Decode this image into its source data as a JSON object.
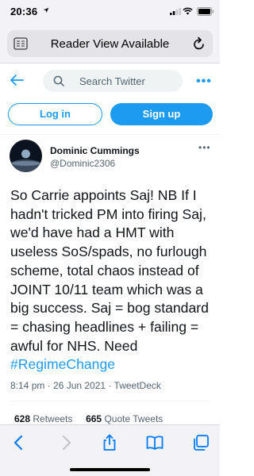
{
  "status_bar": {
    "time": "20:36"
  },
  "browser": {
    "address_text": "Reader View Available"
  },
  "twitter_nav": {
    "search_placeholder": "Search Twitter",
    "more": "•••"
  },
  "auth": {
    "login_label": "Log in",
    "signup_label": "Sign up"
  },
  "tweet": {
    "author_name": "Dominic Cummings",
    "author_handle": "@Dominic2306",
    "more": "•••",
    "text": "So Carrie appoints Saj! NB If I hadn't tricked PM into firing Saj, we'd have had a HMT with useless SoS/spads, no furlough scheme, total chaos instead of JOINT 10/11 team which was a big success. Saj = bog standard = chasing headlines + failing = awful for NHS. Need ",
    "hashtag": "#RegimeChange",
    "meta": "8:14 pm · 26 Jun 2021 · TweetDeck",
    "retweets_count": "628",
    "retweets_label": "Retweets",
    "quotes_count": "665",
    "quotes_label": "Quote Tweets"
  },
  "colors": {
    "accent": "#1d9bf0",
    "safari_blue": "#007aff",
    "text": "#0f1419",
    "muted": "#536471"
  },
  "icons": [
    "location-arrow-icon",
    "signal-icon",
    "wifi-icon",
    "battery-icon",
    "reader-view-icon",
    "reload-icon",
    "back-arrow-icon",
    "search-icon",
    "safari-back-icon",
    "safari-forward-icon",
    "share-icon",
    "bookmarks-icon",
    "tabs-icon"
  ]
}
